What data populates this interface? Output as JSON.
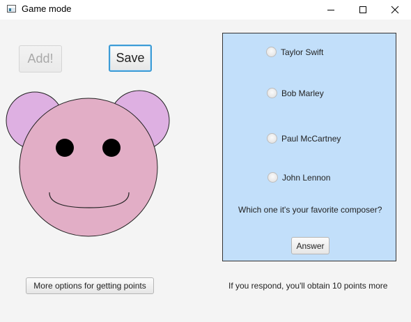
{
  "window": {
    "title": "Game mode",
    "icon": "app-window-icon"
  },
  "controls": {
    "minimize_icon": "minimize-icon",
    "maximize_icon": "maximize-icon",
    "close_icon": "close-icon"
  },
  "toolbar": {
    "add_label": "Add!",
    "save_label": "Save"
  },
  "bear": {
    "face_color": "#e2aec6",
    "ear_color": "#deb0e2",
    "eye_color": "#000000"
  },
  "quiz": {
    "options": [
      {
        "label": "Taylor Swift",
        "selected": false
      },
      {
        "label": "Bob Marley",
        "selected": false
      },
      {
        "label": "Paul McCartney",
        "selected": false
      },
      {
        "label": "John Lennon",
        "selected": false
      }
    ],
    "question": "Which one it's your favorite composer?",
    "answer_label": "Answer",
    "panel_color": "#c2dffa"
  },
  "footer": {
    "more_options_label": "More options for getting points",
    "points_note": "If you respond, you'll obtain 10 points more"
  }
}
